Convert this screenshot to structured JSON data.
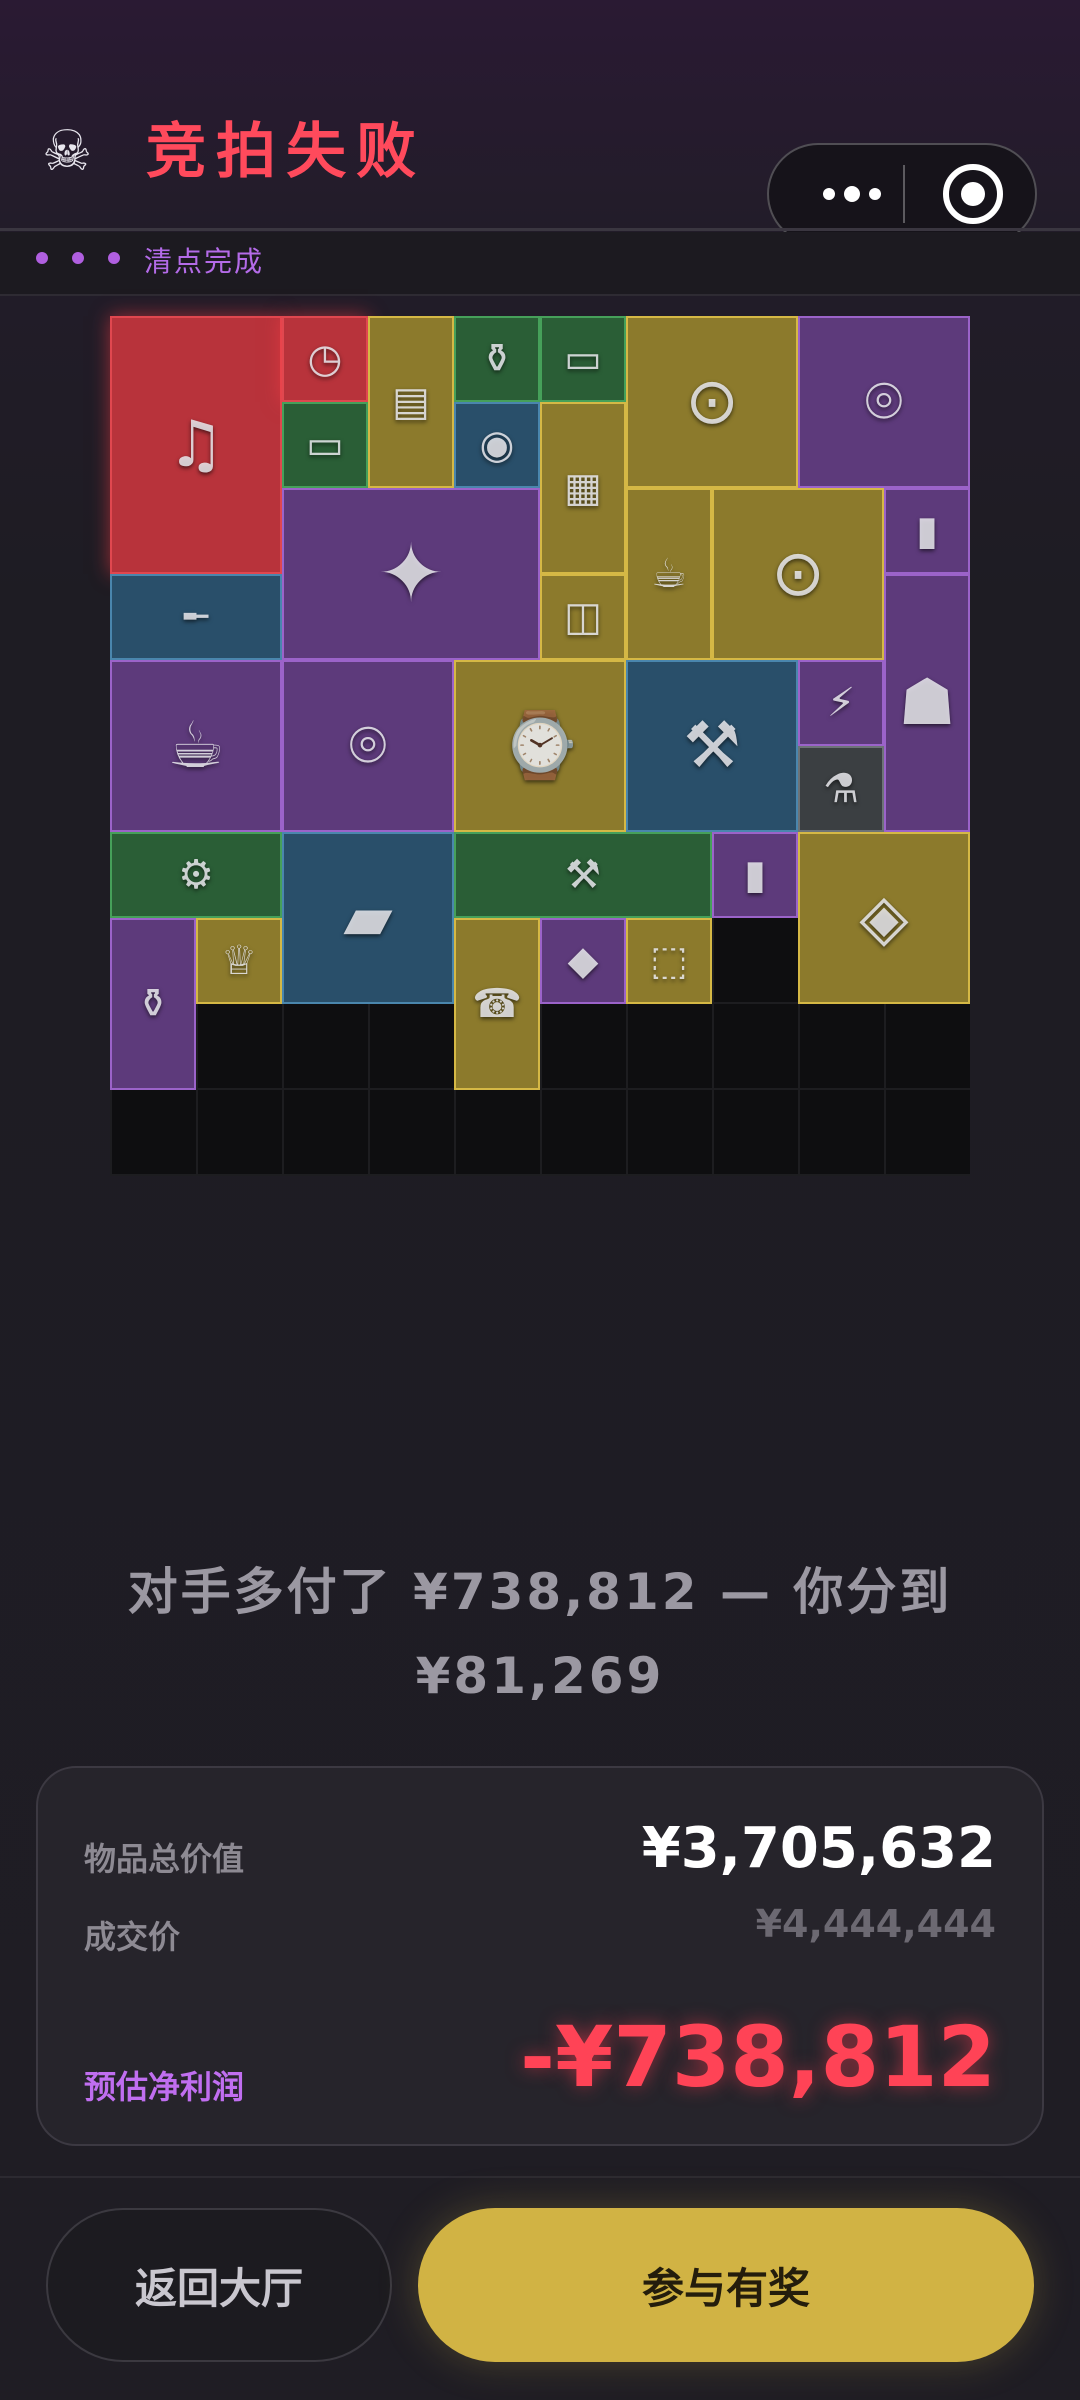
{
  "header": {
    "skull_icon": "skull-icon",
    "title": "竞拍失败",
    "status_text": "清点完成"
  },
  "grid": {
    "items": [
      {
        "name": "gramophone",
        "rarity": "red",
        "glyph": "♫"
      },
      {
        "name": "pocket-watch",
        "rarity": "red",
        "glyph": "◷"
      },
      {
        "name": "book",
        "rarity": "gold",
        "glyph": "▤"
      },
      {
        "name": "medicine-bottle",
        "rarity": "green",
        "glyph": "⚱"
      },
      {
        "name": "power-strip",
        "rarity": "green",
        "glyph": "▭"
      },
      {
        "name": "night-vision-headset",
        "rarity": "gold",
        "glyph": "⊙"
      },
      {
        "name": "centrifuge",
        "rarity": "purple",
        "glyph": "⌾"
      },
      {
        "name": "power-strip",
        "rarity": "green",
        "glyph": "▭"
      },
      {
        "name": "security-camera",
        "rarity": "blue",
        "glyph": "◉"
      },
      {
        "name": "document",
        "rarity": "gold",
        "glyph": "▦"
      },
      {
        "name": "combat-knife",
        "rarity": "purple",
        "glyph": "✦"
      },
      {
        "name": "coffee-beans",
        "rarity": "gold",
        "glyph": "☕"
      },
      {
        "name": "night-vision-headset",
        "rarity": "gold",
        "glyph": "⊙"
      },
      {
        "name": "snack-bar",
        "rarity": "purple",
        "glyph": "▮"
      },
      {
        "name": "assault-rifle",
        "rarity": "blue",
        "glyph": "╾"
      },
      {
        "name": "cylinder",
        "rarity": "gold",
        "glyph": "◫"
      },
      {
        "name": "lantern",
        "rarity": "purple",
        "glyph": "☗"
      },
      {
        "name": "coffee-machine",
        "rarity": "purple",
        "glyph": "☕"
      },
      {
        "name": "centrifuge",
        "rarity": "purple",
        "glyph": "⌾"
      },
      {
        "name": "antique-clock",
        "rarity": "gold",
        "glyph": "⌚"
      },
      {
        "name": "rotary-hammer",
        "rarity": "blue",
        "glyph": "⚒"
      },
      {
        "name": "flashlight",
        "rarity": "purple",
        "glyph": "⚡"
      },
      {
        "name": "sprayer",
        "rarity": "gray",
        "glyph": "⚗"
      },
      {
        "name": "electric-drill",
        "rarity": "green",
        "glyph": "⚙"
      },
      {
        "name": "tablet",
        "rarity": "blue",
        "glyph": "▰"
      },
      {
        "name": "sledgehammer",
        "rarity": "green",
        "glyph": "⚒"
      },
      {
        "name": "snack-bar",
        "rarity": "purple",
        "glyph": "▮"
      },
      {
        "name": "satellite-dish",
        "rarity": "gold",
        "glyph": "◈"
      },
      {
        "name": "golden-teapot",
        "rarity": "purple",
        "glyph": "⚱"
      },
      {
        "name": "golden-goblet",
        "rarity": "gold",
        "glyph": "♕"
      },
      {
        "name": "satellite-phone",
        "rarity": "gold",
        "glyph": "☎"
      },
      {
        "name": "ornament-stone",
        "rarity": "purple",
        "glyph": "◆"
      },
      {
        "name": "cube-device",
        "rarity": "gold",
        "glyph": "⬚"
      }
    ]
  },
  "message": "对手多付了 ¥738,812 — 你分到 ¥81,269",
  "summary": {
    "total_value_label": "物品总价值",
    "total_value": "¥3,705,632",
    "deal_price_label": "成交价",
    "deal_price": "¥4,444,444",
    "profit_label": "预估净利润",
    "profit": "-¥738,812"
  },
  "buttons": {
    "back": "返回大厅",
    "join": "参与有奖"
  },
  "colors": {
    "title_red": "#ff4a5c",
    "accent_purple": "#b46be8",
    "profit_red": "#ff4356",
    "button_gold": "#d1b344"
  }
}
